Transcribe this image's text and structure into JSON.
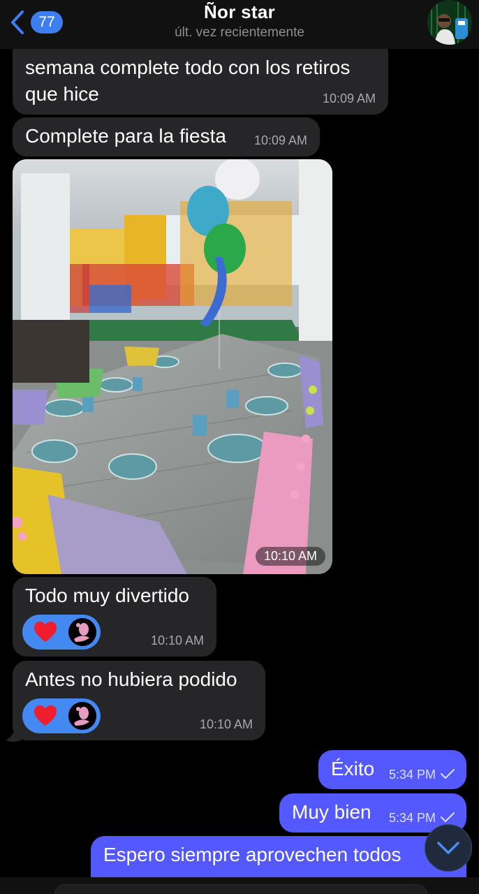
{
  "header": {
    "back_count": "77",
    "contact_name": "Ñor star",
    "status": "últ. vez recientemente"
  },
  "messages": [
    {
      "lines": [
        "semana complete todo con los retiros",
        "que hice"
      ],
      "time": "10:09 AM"
    },
    {
      "text": "Complete para la fiesta",
      "time": "10:09 AM"
    },
    {
      "type": "photo",
      "time": "10:10 AM"
    },
    {
      "text": "Todo muy divertido",
      "time": "10:10 AM",
      "reaction": "heart"
    },
    {
      "text": "Antes no hubiera podido",
      "time": "10:10 AM",
      "reaction": "heart"
    },
    {
      "text": "Éxito",
      "time": "5:34 PM"
    },
    {
      "text": "Muy bien",
      "time": "5:34 PM"
    },
    {
      "text": "Espero siempre aprovechen todos"
    }
  ],
  "colors": {
    "incoming": "#262628",
    "outgoing": "#5458ff",
    "accent": "#3d7ef0",
    "reaction": "#4488f2"
  },
  "icons": [
    "back-chevron-icon",
    "heart-icon",
    "checkmark-icon",
    "chevron-down-icon"
  ]
}
